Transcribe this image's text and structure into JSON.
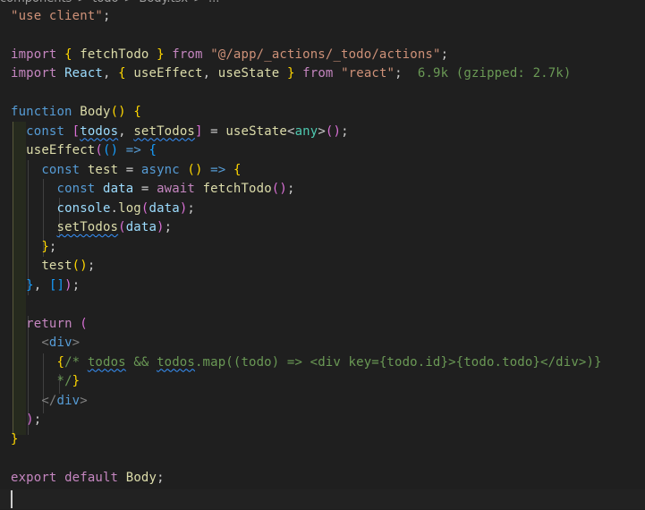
{
  "breadcrumb": {
    "items": [
      "components",
      "todo",
      "Body.tsx",
      "..."
    ],
    "separator": ">"
  },
  "editor": {
    "language": "typescriptreact",
    "lines": [
      {
        "tokens": [
          [
            "str",
            "\"use client\""
          ],
          [
            "punc",
            ";"
          ]
        ]
      },
      {
        "tokens": []
      },
      {
        "tokens": [
          [
            "kw-ctrl",
            "import"
          ],
          [
            "punc",
            " "
          ],
          [
            "br1",
            "{"
          ],
          [
            "punc",
            " "
          ],
          [
            "fn",
            "fetchTodo"
          ],
          [
            "punc",
            " "
          ],
          [
            "br1",
            "}"
          ],
          [
            "punc",
            " "
          ],
          [
            "kw-ctrl",
            "from"
          ],
          [
            "punc",
            " "
          ],
          [
            "str",
            "\"@/app/_actions/_todo/actions\""
          ],
          [
            "punc",
            ";"
          ]
        ]
      },
      {
        "tokens": [
          [
            "kw-ctrl",
            "import"
          ],
          [
            "punc",
            " "
          ],
          [
            "var",
            "React"
          ],
          [
            "punc",
            ", "
          ],
          [
            "br1",
            "{"
          ],
          [
            "punc",
            " "
          ],
          [
            "fn",
            "useEffect"
          ],
          [
            "punc",
            ", "
          ],
          [
            "fn",
            "useState"
          ],
          [
            "punc",
            " "
          ],
          [
            "br1",
            "}"
          ],
          [
            "punc",
            " "
          ],
          [
            "kw-ctrl",
            "from"
          ],
          [
            "punc",
            " "
          ],
          [
            "str",
            "\"react\""
          ],
          [
            "punc",
            ";  "
          ],
          [
            "hint",
            "6.9k (gzipped: 2.7k)"
          ]
        ]
      },
      {
        "tokens": []
      },
      {
        "tokens": [
          [
            "kw",
            "function"
          ],
          [
            "punc",
            " "
          ],
          [
            "fn",
            "Body"
          ],
          [
            "br1",
            "()"
          ],
          [
            "punc",
            " "
          ],
          [
            "br1",
            "{"
          ]
        ]
      },
      {
        "tokens": [
          [
            "punc",
            "  "
          ],
          [
            "kw",
            "const"
          ],
          [
            "punc",
            " "
          ],
          [
            "br2",
            "["
          ],
          [
            "var squig",
            "todos"
          ],
          [
            "punc",
            ", "
          ],
          [
            "fn squig",
            "setTodos"
          ],
          [
            "br2",
            "]"
          ],
          [
            "punc",
            " = "
          ],
          [
            "fn",
            "useState"
          ],
          [
            "punc",
            "<"
          ],
          [
            "cls",
            "any"
          ],
          [
            "punc",
            ">"
          ],
          [
            "br2",
            "()"
          ],
          [
            "punc",
            ";"
          ]
        ]
      },
      {
        "tokens": [
          [
            "punc",
            "  "
          ],
          [
            "fn",
            "useEffect"
          ],
          [
            "br2",
            "("
          ],
          [
            "br3",
            "()"
          ],
          [
            "punc",
            " "
          ],
          [
            "kw",
            "=>"
          ],
          [
            "punc",
            " "
          ],
          [
            "br3",
            "{"
          ]
        ]
      },
      {
        "tokens": [
          [
            "punc",
            "    "
          ],
          [
            "kw",
            "const"
          ],
          [
            "punc",
            " "
          ],
          [
            "fn",
            "test"
          ],
          [
            "punc",
            " = "
          ],
          [
            "kw",
            "async"
          ],
          [
            "punc",
            " "
          ],
          [
            "br1",
            "()"
          ],
          [
            "punc",
            " "
          ],
          [
            "kw",
            "=>"
          ],
          [
            "punc",
            " "
          ],
          [
            "br1",
            "{"
          ]
        ]
      },
      {
        "tokens": [
          [
            "punc",
            "      "
          ],
          [
            "kw",
            "const"
          ],
          [
            "punc",
            " "
          ],
          [
            "var",
            "data"
          ],
          [
            "punc",
            " = "
          ],
          [
            "kw-ctrl",
            "await"
          ],
          [
            "punc",
            " "
          ],
          [
            "fn",
            "fetchTodo"
          ],
          [
            "br2",
            "()"
          ],
          [
            "punc",
            ";"
          ]
        ]
      },
      {
        "tokens": [
          [
            "punc",
            "      "
          ],
          [
            "var",
            "console"
          ],
          [
            "punc",
            "."
          ],
          [
            "fn",
            "log"
          ],
          [
            "br2",
            "("
          ],
          [
            "var",
            "data"
          ],
          [
            "br2",
            ")"
          ],
          [
            "punc",
            ";"
          ]
        ]
      },
      {
        "tokens": [
          [
            "punc",
            "      "
          ],
          [
            "fn squig",
            "setTodos"
          ],
          [
            "br2",
            "("
          ],
          [
            "var",
            "data"
          ],
          [
            "br2",
            ")"
          ],
          [
            "punc",
            ";"
          ]
        ]
      },
      {
        "tokens": [
          [
            "punc",
            "    "
          ],
          [
            "br1",
            "}"
          ],
          [
            "punc",
            ";"
          ]
        ]
      },
      {
        "tokens": [
          [
            "punc",
            "    "
          ],
          [
            "fn",
            "test"
          ],
          [
            "br1",
            "()"
          ],
          [
            "punc",
            ";"
          ]
        ]
      },
      {
        "tokens": [
          [
            "punc",
            "  "
          ],
          [
            "br3",
            "}"
          ],
          [
            "punc",
            ", "
          ],
          [
            "br3",
            "[]"
          ],
          [
            "br2",
            ")"
          ],
          [
            "punc",
            ";"
          ]
        ]
      },
      {
        "tokens": []
      },
      {
        "tokens": [
          [
            "punc",
            "  "
          ],
          [
            "kw-ctrl",
            "return"
          ],
          [
            "punc",
            " "
          ],
          [
            "br2",
            "("
          ]
        ]
      },
      {
        "tokens": [
          [
            "punc",
            "    "
          ],
          [
            "tag",
            "<"
          ],
          [
            "kw",
            "div"
          ],
          [
            "tag",
            ">"
          ]
        ]
      },
      {
        "tokens": [
          [
            "punc",
            "      "
          ],
          [
            "br1",
            "{"
          ],
          [
            "cmt",
            "/* "
          ],
          [
            "cmt squig",
            "todos"
          ],
          [
            "cmt",
            " && "
          ],
          [
            "cmt squig",
            "todos"
          ],
          [
            "cmt",
            ".map((todo) => <div key={todo.id}>{todo.todo}</div>)}"
          ]
        ]
      },
      {
        "tokens": [
          [
            "punc",
            "      "
          ],
          [
            "cmt",
            "*/"
          ],
          [
            "br1",
            "}"
          ]
        ]
      },
      {
        "tokens": [
          [
            "punc",
            "    "
          ],
          [
            "tag",
            "</"
          ],
          [
            "kw",
            "div"
          ],
          [
            "tag",
            ">"
          ]
        ]
      },
      {
        "tokens": [
          [
            "punc",
            "  "
          ],
          [
            "br2",
            ")"
          ],
          [
            "punc",
            ";"
          ]
        ]
      },
      {
        "tokens": [
          [
            "br1",
            "}"
          ]
        ]
      },
      {
        "tokens": []
      },
      {
        "tokens": [
          [
            "kw-ctrl",
            "export"
          ],
          [
            "punc",
            " "
          ],
          [
            "kw-ctrl",
            "default"
          ],
          [
            "punc",
            " "
          ],
          [
            "fn",
            "Body"
          ],
          [
            "punc",
            ";"
          ]
        ]
      },
      {
        "tokens": []
      }
    ]
  }
}
